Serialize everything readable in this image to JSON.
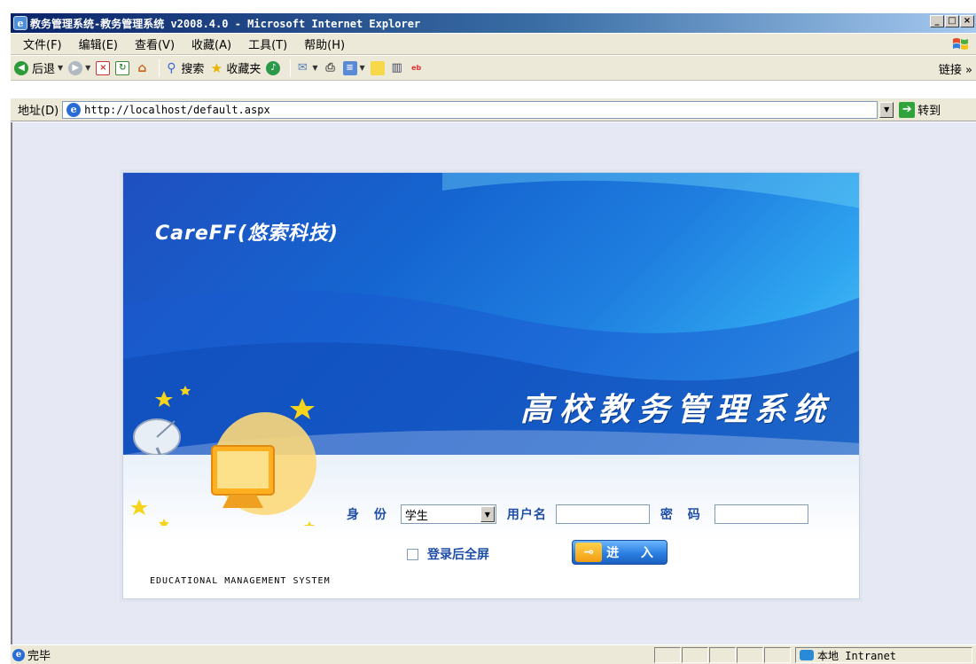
{
  "window": {
    "title": "教务管理系统-教务管理系统 v2008.4.0 - Microsoft Internet Explorer",
    "controls": [
      "_",
      "□",
      "×"
    ]
  },
  "menu": {
    "items": [
      "文件(F)",
      "编辑(E)",
      "查看(V)",
      "收藏(A)",
      "工具(T)",
      "帮助(H)"
    ]
  },
  "toolbar": {
    "back": "后退",
    "search": "搜索",
    "favorites": "收藏夹",
    "links": "链接 »"
  },
  "address": {
    "label": "地址(D)",
    "url": "http://localhost/default.aspx",
    "go": "转到"
  },
  "login": {
    "brand": "CareFF(悠索科技)",
    "system_title": "高校教务管理系统",
    "identity_label": "身 份",
    "identity_value": "学生",
    "username_label": "用户名",
    "password_label": "密 码",
    "fullscreen_label": "登录后全屏",
    "enter_label": "进 入",
    "footer": "EDUCATIONAL MANAGEMENT SYSTEM"
  },
  "status": {
    "text": "完毕",
    "zone": "本地 Intranet"
  },
  "colors": {
    "title_bar": "#0a246a",
    "banner": "#1565d0",
    "form_label": "#1f4ea5"
  }
}
